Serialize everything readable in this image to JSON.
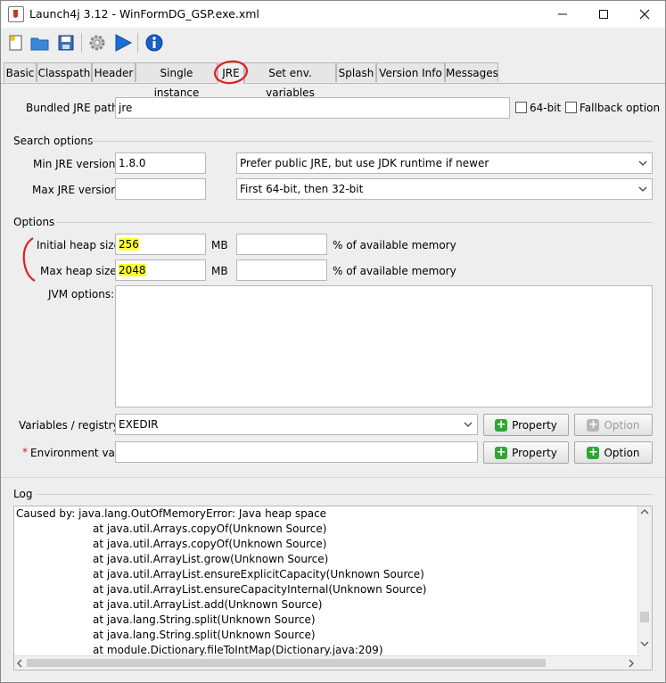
{
  "window": {
    "title": "Launch4j 3.12 - WinFormDG_GSP.exe.xml",
    "minimize": "—",
    "maximize": "☐",
    "close": "✕"
  },
  "toolbar": {
    "icons": [
      "new-file-icon",
      "open-folder-icon",
      "save-icon",
      "build-gear-icon",
      "run-play-icon",
      "about-info-icon"
    ]
  },
  "tabs": [
    "Basic",
    "Classpath",
    "Header",
    "Single instance",
    "JRE",
    "Set env. variables",
    "Splash",
    "Version Info",
    "Messages"
  ],
  "active_tab": "JRE",
  "jre": {
    "bundled_label": "Bundled JRE path:",
    "bundled_value": "jre",
    "bit64_label": "64-bit",
    "fallback_label": "Fallback option",
    "search_options_title": "Search options",
    "min_label": "Min JRE version:",
    "min_value": "1.8.0",
    "max_label": "Max JRE version:",
    "max_value": "",
    "jdk_pref": "Prefer public JRE, but use JDK runtime if newer",
    "arch_pref": "First 64-bit, then 32-bit",
    "options_title": "Options",
    "initial_heap_label": "Initial heap size:",
    "initial_heap_value": "256",
    "max_heap_label": "Max heap size:",
    "max_heap_value": "2048",
    "mb": "MB",
    "percent_label": "% of available memory",
    "jvm_label": "JVM options:",
    "vars_label": "Variables / registry:",
    "vars_value": "EXEDIR",
    "env_required": "*",
    "env_label": "Environment var:",
    "property_btn": "Property",
    "option_btn": "Option"
  },
  "log": {
    "title": "Log",
    "lines": [
      "Caused by: java.lang.OutOfMemoryError: Java heap space",
      "at java.util.Arrays.copyOf(Unknown Source)",
      "at java.util.Arrays.copyOf(Unknown Source)",
      "at java.util.ArrayList.grow(Unknown Source)",
      "at java.util.ArrayList.ensureExplicitCapacity(Unknown Source)",
      "at java.util.ArrayList.ensureCapacityInternal(Unknown Source)",
      "at java.util.ArrayList.add(Unknown Source)",
      "at java.lang.String.split(Unknown Source)",
      "at java.lang.String.split(Unknown Source)",
      "at module.Dictionary.fileToIntMap(Dictionary.java:209)"
    ]
  },
  "colors": {
    "highlight": "#ffff33",
    "annotation_red": "#e02020",
    "accent_blue": "#1a6fd6"
  }
}
